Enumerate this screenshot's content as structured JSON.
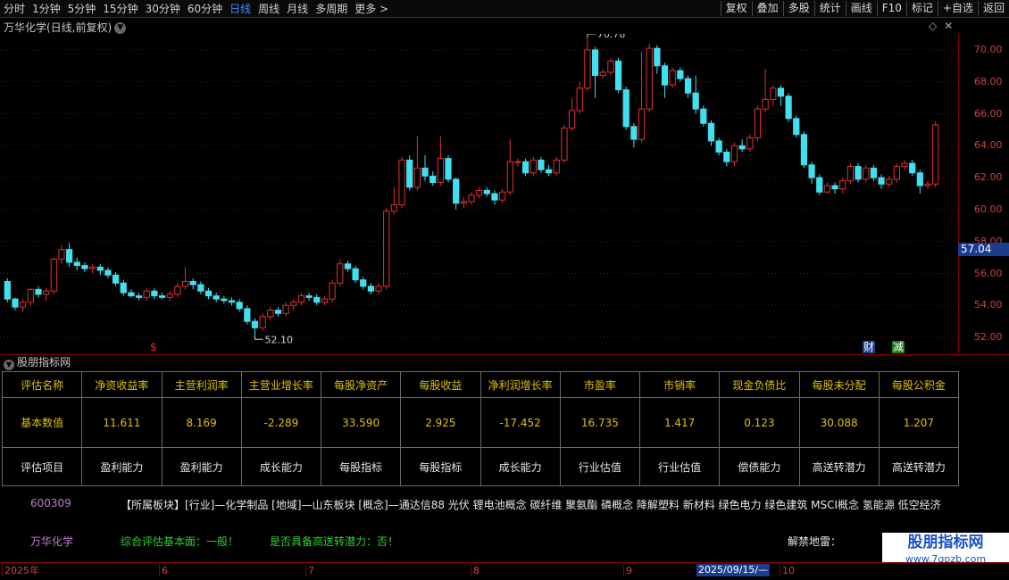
{
  "toolbar": {
    "periods": [
      "分时",
      "1分钟",
      "5分钟",
      "15分钟",
      "30分钟",
      "60分钟",
      "日线",
      "周线",
      "月线",
      "多周期",
      "更多 >"
    ],
    "active_period": "日线",
    "right_buttons": [
      "复权",
      "叠加",
      "多股",
      "统计",
      "画线",
      "F10",
      "标记",
      "+自选",
      "返回"
    ]
  },
  "chart_title": "万华化学(日线,前复权)",
  "price_axis": {
    "ticks": [
      "70.00",
      "68.00",
      "66.00",
      "64.00",
      "62.00",
      "60.00",
      "58.00",
      "56.00",
      "54.00",
      "52.00"
    ],
    "last_price": "57.04"
  },
  "high_label": "70.78",
  "low_label": "52.10",
  "markers": {
    "dollar": "$",
    "cai": "财",
    "jian": "减"
  },
  "colors": {
    "up": "#e03030",
    "down": "#40e0f0",
    "grid": "#8b0000",
    "accent": "#e0c000",
    "positive_text": "#30d030"
  },
  "chart_data": {
    "type": "candlestick",
    "ylim": [
      51,
      71
    ],
    "candles": [
      [
        55.5,
        54.4,
        55.7,
        54.2
      ],
      [
        54.4,
        53.9,
        54.5,
        53.7
      ],
      [
        53.9,
        54.2,
        54.4,
        53.6
      ],
      [
        54.2,
        55.0,
        55.1,
        54.0
      ],
      [
        55.0,
        54.7,
        55.2,
        54.5
      ],
      [
        54.7,
        54.9,
        55.1,
        54.3
      ],
      [
        54.9,
        56.9,
        57.0,
        54.7
      ],
      [
        56.9,
        57.5,
        57.8,
        56.6
      ],
      [
        57.5,
        56.7,
        57.9,
        56.4
      ],
      [
        56.7,
        56.5,
        57.0,
        56.2
      ],
      [
        56.5,
        56.3,
        56.7,
        56.1
      ],
      [
        56.3,
        56.4,
        56.6,
        56.0
      ],
      [
        56.4,
        56.2,
        56.6,
        55.9
      ],
      [
        56.2,
        55.9,
        56.4,
        55.7
      ],
      [
        55.9,
        55.4,
        56.1,
        55.2
      ],
      [
        55.4,
        54.8,
        55.6,
        54.6
      ],
      [
        54.8,
        54.6,
        55.0,
        54.5
      ],
      [
        54.6,
        54.5,
        54.8,
        54.3
      ],
      [
        54.5,
        54.9,
        55.1,
        54.3
      ],
      [
        54.9,
        54.6,
        55.1,
        54.4
      ],
      [
        54.6,
        54.5,
        54.8,
        54.4
      ],
      [
        54.5,
        54.7,
        54.9,
        54.3
      ],
      [
        54.7,
        55.2,
        55.4,
        54.5
      ],
      [
        55.2,
        55.5,
        56.4,
        55.0
      ],
      [
        55.5,
        55.3,
        55.7,
        55.0
      ],
      [
        55.3,
        54.9,
        55.5,
        54.7
      ],
      [
        54.9,
        54.6,
        55.1,
        54.4
      ],
      [
        54.6,
        54.4,
        54.8,
        54.2
      ],
      [
        54.4,
        54.3,
        54.6,
        54.1
      ],
      [
        54.3,
        54.2,
        54.5,
        54.0
      ],
      [
        54.2,
        53.8,
        54.4,
        53.6
      ],
      [
        53.8,
        53.0,
        54.0,
        52.8
      ],
      [
        53.0,
        52.6,
        53.2,
        52.1
      ],
      [
        52.6,
        53.3,
        53.5,
        52.4
      ],
      [
        53.3,
        53.7,
        53.9,
        53.1
      ],
      [
        53.7,
        53.5,
        53.9,
        53.3
      ],
      [
        53.5,
        54.0,
        54.2,
        53.3
      ],
      [
        54.0,
        54.2,
        54.4,
        53.7
      ],
      [
        54.2,
        54.6,
        54.8,
        54.0
      ],
      [
        54.6,
        54.5,
        54.8,
        54.3
      ],
      [
        54.5,
        54.2,
        54.7,
        54.0
      ],
      [
        54.2,
        54.4,
        54.6,
        54.0
      ],
      [
        54.4,
        55.4,
        55.6,
        54.2
      ],
      [
        55.4,
        56.6,
        56.9,
        55.2
      ],
      [
        56.6,
        56.3,
        56.8,
        56.1
      ],
      [
        56.3,
        55.6,
        56.5,
        55.4
      ],
      [
        55.6,
        55.2,
        55.8,
        55.0
      ],
      [
        55.2,
        54.9,
        55.4,
        54.7
      ],
      [
        54.9,
        55.2,
        55.4,
        54.7
      ],
      [
        55.2,
        59.9,
        60.1,
        55.0
      ],
      [
        59.9,
        60.3,
        61.4,
        59.7
      ],
      [
        60.3,
        63.1,
        63.3,
        60.1
      ],
      [
        63.1,
        61.4,
        63.4,
        61.2
      ],
      [
        61.4,
        62.6,
        64.6,
        61.2
      ],
      [
        62.6,
        62.1,
        63.4,
        61.8
      ],
      [
        62.1,
        61.7,
        62.4,
        61.5
      ],
      [
        61.7,
        63.2,
        64.6,
        61.5
      ],
      [
        63.2,
        61.9,
        63.4,
        61.7
      ],
      [
        61.9,
        60.4,
        62.0,
        60.0
      ],
      [
        60.4,
        60.5,
        60.8,
        60.1
      ],
      [
        60.5,
        60.9,
        61.1,
        60.3
      ],
      [
        60.9,
        61.2,
        61.4,
        60.7
      ],
      [
        61.2,
        61.0,
        61.4,
        60.8
      ],
      [
        61.0,
        60.6,
        61.2,
        60.3
      ],
      [
        60.6,
        61.1,
        61.3,
        60.4
      ],
      [
        61.1,
        63.0,
        64.4,
        60.9
      ],
      [
        63.0,
        63.0,
        63.2,
        62.7
      ],
      [
        63.0,
        62.3,
        63.2,
        62.1
      ],
      [
        62.3,
        63.1,
        63.3,
        62.1
      ],
      [
        63.1,
        62.5,
        63.3,
        62.3
      ],
      [
        62.5,
        62.3,
        62.8,
        62.1
      ],
      [
        62.3,
        63.1,
        63.3,
        62.1
      ],
      [
        63.1,
        65.1,
        65.3,
        62.9
      ],
      [
        65.1,
        66.2,
        67.0,
        64.9
      ],
      [
        66.2,
        67.6,
        68.0,
        66.0
      ],
      [
        67.6,
        70.0,
        70.78,
        67.4
      ],
      [
        70.0,
        68.4,
        70.2,
        67.0
      ],
      [
        68.4,
        68.6,
        68.8,
        68.2
      ],
      [
        68.6,
        69.3,
        69.5,
        68.4
      ],
      [
        69.3,
        67.5,
        69.5,
        67.3
      ],
      [
        67.5,
        65.2,
        67.7,
        65.0
      ],
      [
        65.2,
        64.4,
        65.4,
        63.9
      ],
      [
        64.4,
        66.3,
        69.9,
        64.2
      ],
      [
        66.3,
        70.1,
        70.4,
        66.1
      ],
      [
        70.1,
        69.0,
        70.3,
        68.5
      ],
      [
        69.0,
        67.8,
        69.2,
        67.0
      ],
      [
        67.8,
        68.7,
        68.9,
        67.6
      ],
      [
        68.7,
        68.2,
        68.9,
        68.0
      ],
      [
        68.2,
        67.3,
        68.4,
        67.0
      ],
      [
        67.3,
        66.3,
        68.4,
        66.0
      ],
      [
        66.3,
        65.4,
        66.5,
        65.2
      ],
      [
        65.4,
        64.3,
        65.6,
        64.0
      ],
      [
        64.3,
        63.6,
        64.5,
        63.4
      ],
      [
        63.6,
        63.0,
        63.8,
        62.7
      ],
      [
        63.0,
        64.0,
        64.2,
        62.7
      ],
      [
        64.0,
        63.8,
        64.4,
        63.6
      ],
      [
        63.8,
        64.5,
        64.7,
        63.6
      ],
      [
        64.5,
        66.3,
        66.5,
        64.3
      ],
      [
        66.3,
        66.9,
        68.8,
        66.1
      ],
      [
        66.9,
        67.6,
        67.8,
        66.5
      ],
      [
        67.6,
        67.1,
        67.8,
        66.5
      ],
      [
        67.1,
        65.7,
        67.3,
        65.5
      ],
      [
        65.7,
        64.7,
        65.9,
        64.5
      ],
      [
        64.7,
        62.8,
        64.9,
        62.6
      ],
      [
        62.8,
        62.0,
        63.0,
        61.6
      ],
      [
        62.0,
        61.1,
        62.2,
        60.9
      ],
      [
        61.1,
        61.5,
        61.7,
        61.0
      ],
      [
        61.5,
        61.3,
        61.7,
        61.0
      ],
      [
        61.3,
        61.8,
        62.0,
        61.0
      ],
      [
        61.8,
        62.7,
        62.9,
        61.6
      ],
      [
        62.7,
        61.9,
        62.9,
        61.7
      ],
      [
        61.9,
        62.6,
        62.8,
        61.7
      ],
      [
        62.6,
        62.0,
        62.8,
        61.8
      ],
      [
        62.0,
        61.6,
        62.2,
        61.3
      ],
      [
        61.6,
        61.9,
        62.1,
        61.4
      ],
      [
        61.9,
        62.7,
        62.9,
        61.7
      ],
      [
        62.7,
        62.9,
        63.1,
        62.5
      ],
      [
        62.9,
        62.3,
        63.1,
        62.1
      ],
      [
        62.3,
        61.5,
        62.5,
        61.0
      ],
      [
        61.5,
        61.6,
        61.8,
        61.3
      ],
      [
        61.6,
        65.3,
        65.5,
        61.4
      ]
    ]
  },
  "panel_title": "股朋指标网",
  "metrics": {
    "header_label": "评估名称",
    "headers": [
      "净资收益率",
      "主营利润率",
      "主营业增长率",
      "每股净资产",
      "每股收益",
      "净利润增长率",
      "市盈率",
      "市销率",
      "现金负债比",
      "每股未分配",
      "每股公积金"
    ],
    "value_label": "基本数值",
    "values": [
      "11.611",
      "8.169",
      "-2.289",
      "33.590",
      "2.925",
      "-17.452",
      "16.735",
      "1.417",
      "0.123",
      "30.088",
      "1.207"
    ],
    "category_label": "评估项目",
    "categories": [
      "盈利能力",
      "盈利能力",
      "成长能力",
      "每股指标",
      "每股指标",
      "成长能力",
      "行业估值",
      "行业估值",
      "偿债能力",
      "高送转潜力",
      "高送转潜力"
    ]
  },
  "stock": {
    "code": "600309",
    "name": "万华化学",
    "sectors": "【所属板块】[行业]—化学制品 [地域]—山东板块 [概念]—通达信88 光伏 锂电池概念 碳纤维 聚氨酯 磷概念 降解塑料 新材料 绿色电力 绿色建筑 MSCI概念 氢能源 低空经济",
    "evaluation": "综合评估基本面：一般！",
    "transfer": "是否具备高送转潜力：否！",
    "unlock": "解禁地雷："
  },
  "watermark": {
    "title": "股朋指标网",
    "url": "www.7gpzb.com"
  },
  "date_axis": {
    "labels": [
      "2025年",
      "6",
      "7",
      "8",
      "9",
      "10"
    ],
    "cursor": "2025/09/15/—"
  }
}
